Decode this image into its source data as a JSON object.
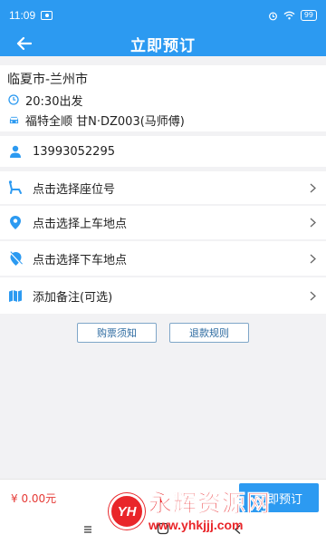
{
  "status_bar": {
    "time": "11:09",
    "battery": "99"
  },
  "header": {
    "title": "立即预订"
  },
  "trip": {
    "route": "临夏市-兰州市",
    "departure": "20:30出发",
    "vehicle": "福特全顺 甘N·DZ003(马师傅)"
  },
  "phone": "13993052295",
  "options": [
    {
      "label": "点击选择座位号"
    },
    {
      "label": "点击选择上车地点"
    },
    {
      "label": "点击选择下车地点"
    },
    {
      "label": "添加备注(可选)"
    }
  ],
  "buttons": {
    "ticket_notice": "购票须知",
    "refund_rules": "退款规则"
  },
  "footer": {
    "price": "¥ 0.00元",
    "book": "立即预订"
  },
  "watermark": {
    "logo": "YH",
    "title": "永辉资源网",
    "url": "www.yhkjjj.com"
  },
  "colors": {
    "primary": "#2c9af1",
    "price": "#e53935",
    "watermark": "#e9262a"
  }
}
